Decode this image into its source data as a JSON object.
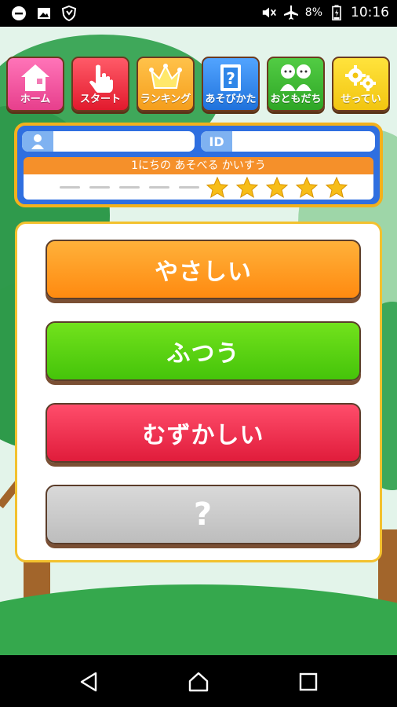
{
  "status_bar": {
    "battery": "8%",
    "time": "10:16",
    "left_icons": [
      "minus-circle-icon",
      "image-icon",
      "shield-icon"
    ],
    "right_icons": [
      "mute-icon",
      "airplane-icon",
      "battery-icon"
    ]
  },
  "menu": {
    "home": "ホーム",
    "start": "スタート",
    "ranking": "ランキング",
    "howto": "あそびかた",
    "friends": "おともだち",
    "settings": "せってい"
  },
  "profile": {
    "name_value": "",
    "id_tag": "ID",
    "id_value": ""
  },
  "play_counter": {
    "title": "1にちの あそべる かいすう",
    "used_dashes": 5,
    "remaining_stars": 5
  },
  "difficulty": {
    "easy": "やさしい",
    "normal": "ふつう",
    "hard": "むずかしい",
    "mystery": "?"
  },
  "colors": {
    "home": "#ee4f9b",
    "start": "#ea2538",
    "ranking": "#f7ac2a",
    "howto": "#2c87e8",
    "friends": "#38b62e",
    "settings": "#f4d21c"
  }
}
